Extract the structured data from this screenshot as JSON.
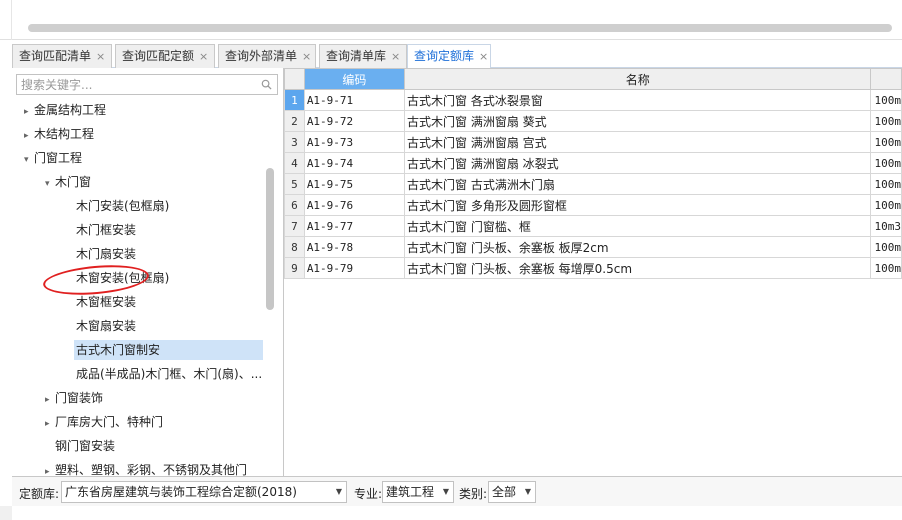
{
  "tabs": [
    {
      "label": "查询匹配清单",
      "close": "×"
    },
    {
      "label": "查询匹配定额",
      "close": "×"
    },
    {
      "label": "查询外部清单",
      "close": "×"
    },
    {
      "label": "查询清单库",
      "close": "×"
    },
    {
      "label": "查询定额库",
      "close": "×",
      "active": true
    }
  ],
  "search": {
    "placeholder": "搜索关键字..."
  },
  "tree": [
    {
      "label": "金属结构工程",
      "arrow": "▸"
    },
    {
      "label": "木结构工程",
      "arrow": "▸"
    },
    {
      "label": "门窗工程",
      "arrow": "▾"
    },
    {
      "label": "木门窗",
      "arrow": "▾"
    },
    {
      "label": "木门安装(包框扇)",
      "arrow": ""
    },
    {
      "label": "木门框安装",
      "arrow": ""
    },
    {
      "label": "木门扇安装",
      "arrow": ""
    },
    {
      "label": "木窗安装(包框扇)",
      "arrow": ""
    },
    {
      "label": "木窗框安装",
      "arrow": ""
    },
    {
      "label": "木窗扇安装",
      "arrow": ""
    },
    {
      "label": "古式木门窗制安",
      "arrow": "",
      "selected": true
    },
    {
      "label": "成品(半成品)木门框、木门(扇)、...",
      "arrow": ""
    },
    {
      "label": "门窗装饰",
      "arrow": "▸"
    },
    {
      "label": "厂库房大门、特种门",
      "arrow": "▸"
    },
    {
      "label": "钢门窗安装",
      "arrow": ""
    },
    {
      "label": "塑料、塑钢、彩钢、不锈钢及其他门",
      "arrow": "▸"
    }
  ],
  "grid": {
    "columns": [
      "编码",
      "名称",
      ""
    ],
    "rows": [
      {
        "num": "1",
        "code": "A1-9-71",
        "name": "古式木门窗 各式冰裂景窗",
        "unit": "100m"
      },
      {
        "num": "2",
        "code": "A1-9-72",
        "name": "古式木门窗 满洲窗扇 葵式",
        "unit": "100m"
      },
      {
        "num": "3",
        "code": "A1-9-73",
        "name": "古式木门窗 满洲窗扇 宫式",
        "unit": "100m"
      },
      {
        "num": "4",
        "code": "A1-9-74",
        "name": "古式木门窗 满洲窗扇 冰裂式",
        "unit": "100m"
      },
      {
        "num": "5",
        "code": "A1-9-75",
        "name": "古式木门窗 古式满洲木门扇",
        "unit": "100m"
      },
      {
        "num": "6",
        "code": "A1-9-76",
        "name": "古式木门窗 多角形及圆形窗框",
        "unit": "100m"
      },
      {
        "num": "7",
        "code": "A1-9-77",
        "name": "古式木门窗 门窗槛、框",
        "unit": "10m3"
      },
      {
        "num": "8",
        "code": "A1-9-78",
        "name": "古式木门窗 门头板、余塞板 板厚2cm",
        "unit": "100m"
      },
      {
        "num": "9",
        "code": "A1-9-79",
        "name": "古式木门窗 门头板、余塞板 每增厚0.5cm",
        "unit": "100m"
      }
    ]
  },
  "bottom": {
    "quota_label": "定额库:",
    "quota_value": "广东省房屋建筑与装饰工程综合定额(2018)",
    "major_label": "专业:",
    "major_value": "建筑工程",
    "category_label": "类别:",
    "category_value": "全部"
  },
  "colors": {
    "accent": "#6aaff0",
    "active_tab_text": "#1e6fd8",
    "annotation": "#e02020",
    "selected_row": "#cfe3f8"
  }
}
